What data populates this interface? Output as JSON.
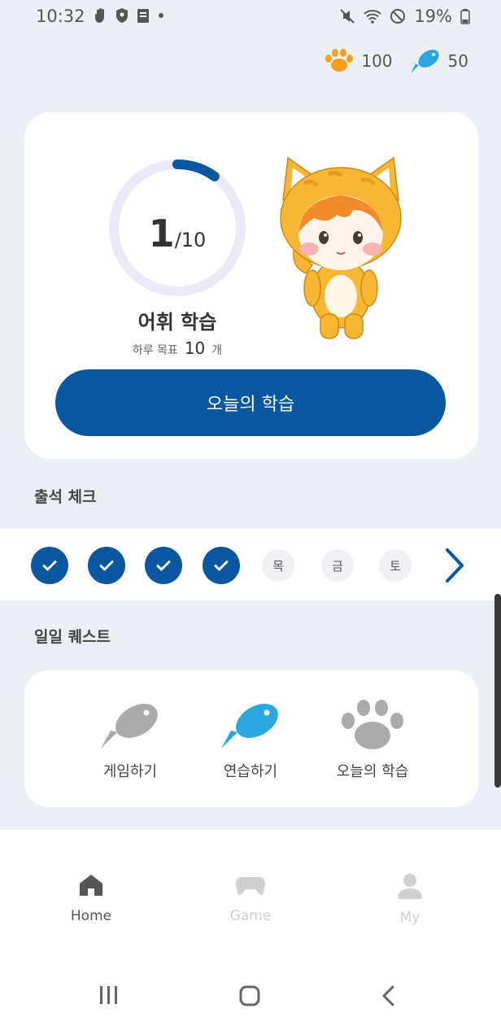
{
  "status_bar": {
    "time": "10:32",
    "battery": "19%",
    "left_icons": [
      "hand-icon",
      "shield-icon",
      "clipboard-icon",
      "dot-icon"
    ],
    "right_icons": [
      "mute-icon",
      "wifi-icon",
      "do-not-disturb-icon",
      "battery-icon"
    ]
  },
  "currency": {
    "paw": {
      "icon": "paw-icon",
      "value": "100",
      "color": "#f5a01a"
    },
    "fish": {
      "icon": "fish-icon",
      "value": "50",
      "color": "#2aa7df"
    }
  },
  "study_card": {
    "current": "1",
    "total": "/10",
    "progress_fraction": 0.1,
    "title": "어휘 학습",
    "goal_label": "하루 목표",
    "goal_value": "10",
    "goal_unit": "개",
    "button_label": "오늘의 학습",
    "accent": "#0b56a1"
  },
  "attendance": {
    "title": "출석 체크",
    "days": [
      {
        "label": "",
        "checked": true
      },
      {
        "label": "",
        "checked": true
      },
      {
        "label": "",
        "checked": true
      },
      {
        "label": "",
        "checked": true
      },
      {
        "label": "목",
        "checked": false
      },
      {
        "label": "금",
        "checked": false
      },
      {
        "label": "토",
        "checked": false
      }
    ]
  },
  "quests": {
    "title": "일일 퀘스트",
    "items": [
      {
        "label": "게임하기",
        "icon": "fish-icon",
        "done": false
      },
      {
        "label": "연습하기",
        "icon": "fish-icon",
        "done": true
      },
      {
        "label": "오늘의 학습",
        "icon": "paw-icon",
        "done": false
      }
    ]
  },
  "bottom_nav": {
    "items": [
      {
        "label": "Home",
        "icon": "home-icon",
        "active": true
      },
      {
        "label": "Game",
        "icon": "gamepad-icon",
        "active": false
      },
      {
        "label": "My",
        "icon": "user-icon",
        "active": false
      }
    ]
  },
  "system_nav": [
    "recents-icon",
    "home-circle-icon",
    "back-icon"
  ]
}
